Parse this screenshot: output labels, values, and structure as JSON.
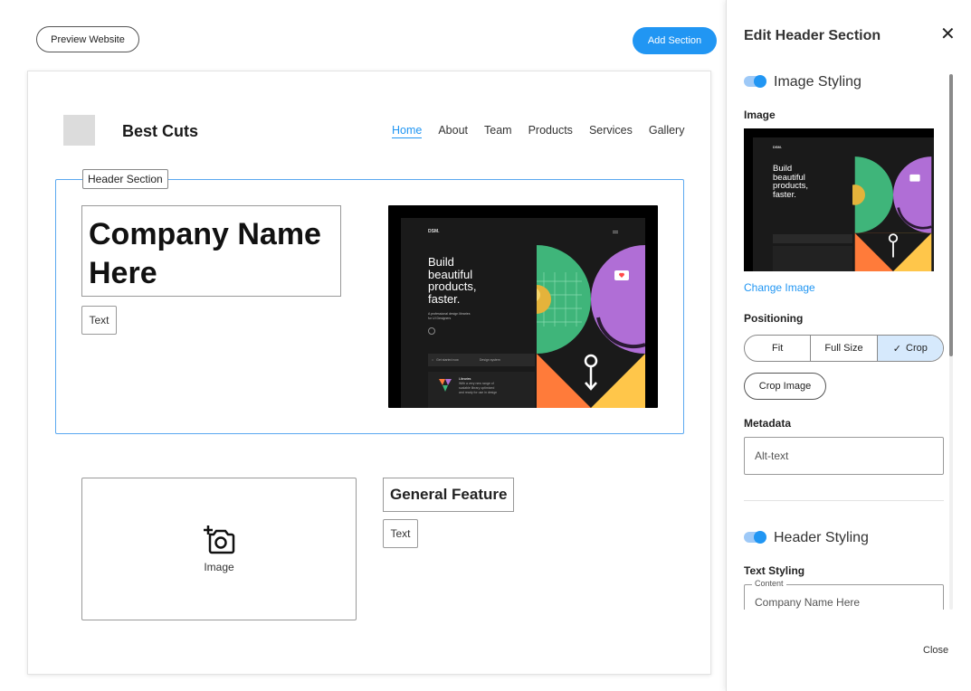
{
  "toolbar": {
    "preview_label": "Preview Website",
    "add_section_label": "Add Section"
  },
  "site": {
    "brand": "Best Cuts",
    "nav": [
      "Home",
      "About",
      "Team",
      "Products",
      "Services",
      "Gallery"
    ],
    "active_nav": "Home"
  },
  "header_section": {
    "tag": "Header Section",
    "company_name_line1": "Company Name",
    "company_name_line2": "Here",
    "text_chip": "Text"
  },
  "hero_image": {
    "logo": "DSM.",
    "headline_line1": "Build",
    "headline_line2": "beautiful",
    "headline_line3": "products,",
    "headline_line4": "faster.",
    "sub_line1": "A professional design libraries",
    "sub_line2": "for UI Designers",
    "search_label": "Get started now",
    "select_label": "Design system",
    "card_title": "Libraries",
    "card_line1": "With a very new range of",
    "card_line2": "scalable library optimized",
    "card_line3": "and ready for use in design"
  },
  "feature": {
    "image_label": "Image",
    "title": "General Feature",
    "text_chip": "Text"
  },
  "panel": {
    "title": "Edit Header Section",
    "image_styling_label": "Image Styling",
    "image_label": "Image",
    "change_image_label": "Change Image",
    "positioning_label": "Positioning",
    "positioning_options": [
      "Fit",
      "Full Size",
      "Crop"
    ],
    "positioning_selected": "Crop",
    "crop_image_label": "Crop Image",
    "metadata_label": "Metadata",
    "alt_text_placeholder": "Alt-text",
    "header_styling_label": "Header Styling",
    "text_styling_label": "Text Styling",
    "content_legend": "Content",
    "content_value": "Company Name Here",
    "close_label": "Close"
  },
  "colors": {
    "accent": "#2196f3",
    "selection_border": "#5aa8f0",
    "segment_selected": "#d6e9fc",
    "hero_green": "#3fb57a",
    "hero_purple": "#b06ed6",
    "hero_orange": "#ff7b3a",
    "hero_yellow": "#ffc64a"
  }
}
